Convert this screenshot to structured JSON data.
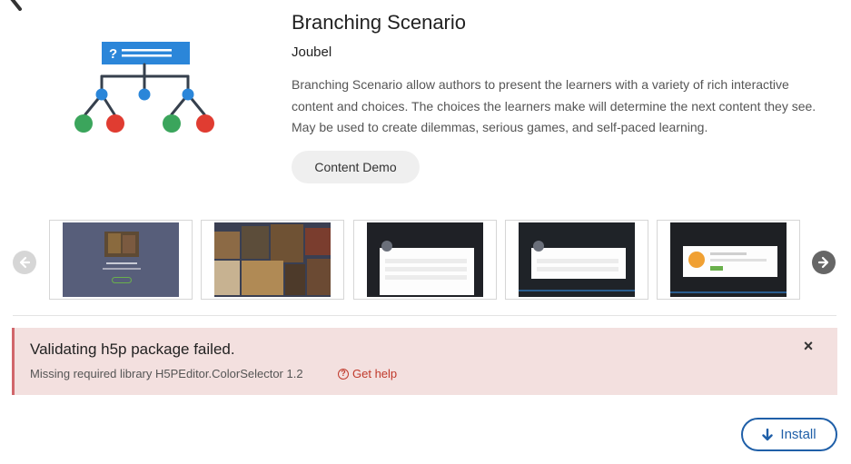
{
  "content_type": {
    "icon": "branching-scenario-icon",
    "title": "Branching Scenario",
    "owner": "Joubel",
    "description": "Branching Scenario allow authors to present the learners with a variety of rich interactive content and choices. The choices the learners make will determine the next content they see. May be used to create dilemmas, serious games, and self-paced learning.",
    "demo_label": "Content Demo"
  },
  "carousel": {
    "prev_icon": "arrow-left-icon",
    "next_icon": "arrow-right-icon",
    "thumbnails": [
      {
        "label": "screenshot-1"
      },
      {
        "label": "screenshot-2"
      },
      {
        "label": "screenshot-3"
      },
      {
        "label": "screenshot-4"
      },
      {
        "label": "screenshot-5"
      }
    ]
  },
  "error": {
    "title": "Validating h5p package failed.",
    "detail": "Missing required library H5PEditor.ColorSelector 1.2",
    "help_label": "Get help",
    "help_icon": "?",
    "close_icon": "×"
  },
  "install": {
    "label": "Install",
    "icon": "download-arrow-icon"
  },
  "colors": {
    "accent_blue": "#1f5fa8",
    "error_bg": "#f3e0df",
    "error_border": "#d1666b",
    "error_link": "#c0392b",
    "node_blue": "#2b86d9",
    "node_green": "#3ba55c",
    "node_red": "#e03c31"
  }
}
